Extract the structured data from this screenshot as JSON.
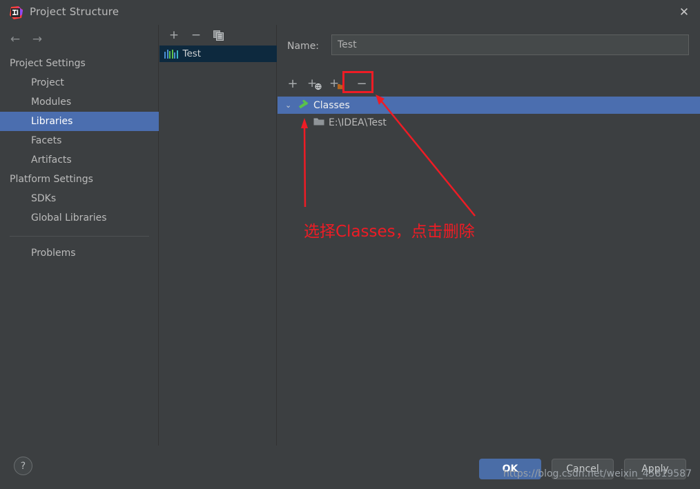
{
  "window": {
    "title": "Project Structure",
    "logo_icon": "intellij-idea-logo",
    "close_icon": "✕"
  },
  "sidebar": {
    "back_icon": "←",
    "forward_icon": "→",
    "groups": [
      {
        "label": "Project Settings",
        "items": [
          {
            "label": "Project",
            "selected": false
          },
          {
            "label": "Modules",
            "selected": false
          },
          {
            "label": "Libraries",
            "selected": true
          },
          {
            "label": "Facets",
            "selected": false
          },
          {
            "label": "Artifacts",
            "selected": false
          }
        ]
      },
      {
        "label": "Platform Settings",
        "items": [
          {
            "label": "SDKs",
            "selected": false
          },
          {
            "label": "Global Libraries",
            "selected": false
          }
        ]
      }
    ],
    "extra_items": [
      {
        "label": "Problems",
        "selected": false
      }
    ]
  },
  "middle_panel": {
    "toolbar": [
      {
        "name": "add-library-button",
        "glyph": "+"
      },
      {
        "name": "remove-library-button",
        "glyph": "−"
      },
      {
        "name": "copy-library-button",
        "glyph": "copy"
      }
    ],
    "items": [
      {
        "label": "Test",
        "selected": true,
        "icon": "library-icon"
      }
    ]
  },
  "detail_panel": {
    "name_label": "Name:",
    "name_value": "Test",
    "name_placeholder": "",
    "toolbar": [
      {
        "name": "add-button",
        "glyph": "+"
      },
      {
        "name": "add-from-maven-button",
        "glyph": "+"
      },
      {
        "name": "add-directory-button",
        "glyph": "+"
      },
      {
        "name": "remove-button",
        "glyph": "−",
        "highlighted": true
      }
    ],
    "tree": [
      {
        "label": "Classes",
        "level": 0,
        "selected": true,
        "expanded": true,
        "icon": "classes-hammer-icon",
        "chevron": "⌄"
      },
      {
        "label": "E:\\IDEA\\Test",
        "level": 1,
        "selected": false,
        "icon": "folder-icon"
      }
    ]
  },
  "bottom_bar": {
    "help_label": "?",
    "buttons": [
      {
        "label": "OK",
        "primary": true
      },
      {
        "label": "Cancel",
        "primary": false
      },
      {
        "label": "Apply",
        "primary": false
      }
    ]
  },
  "annotation": {
    "text": "选择Classes，点击删除",
    "color": "#ee1c25",
    "watermark": "https://blog.csdn.net/weixin_45819587"
  },
  "colors": {
    "background": "#3c3f41",
    "selection_blue": "#4b6eaf",
    "list_selection": "#0d293e",
    "text": "#bbbbbb",
    "annotation_red": "#ee1c25"
  }
}
